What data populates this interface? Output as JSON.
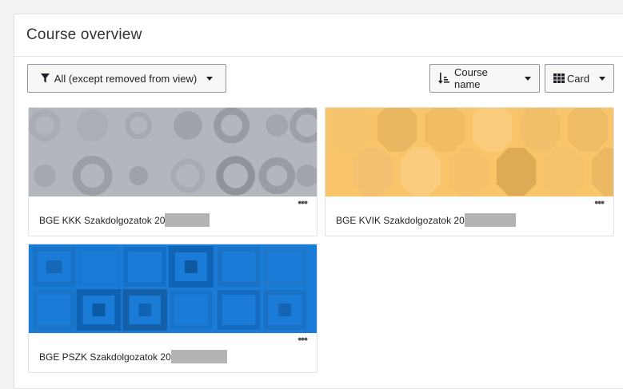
{
  "header": {
    "title": "Course overview"
  },
  "toolbar": {
    "filter_label": "All (except removed from view)",
    "sort_label": "Course name",
    "view_label": "Card"
  },
  "courses": [
    {
      "title": "BGE KKK Szakdolgozatok 20",
      "color": "#b1b7bc"
    },
    {
      "title": "BGE KVIK Szakdolgozatok 20",
      "color": "#f8c56a"
    },
    {
      "title": "BGE PSZK Szakdolgozatok 20",
      "color": "#1a7cd6"
    }
  ],
  "icons": {
    "filter": "filter-icon",
    "sort": "sort-ascending-icon",
    "view": "grid-icon",
    "menu": "ellipsis-icon"
  }
}
